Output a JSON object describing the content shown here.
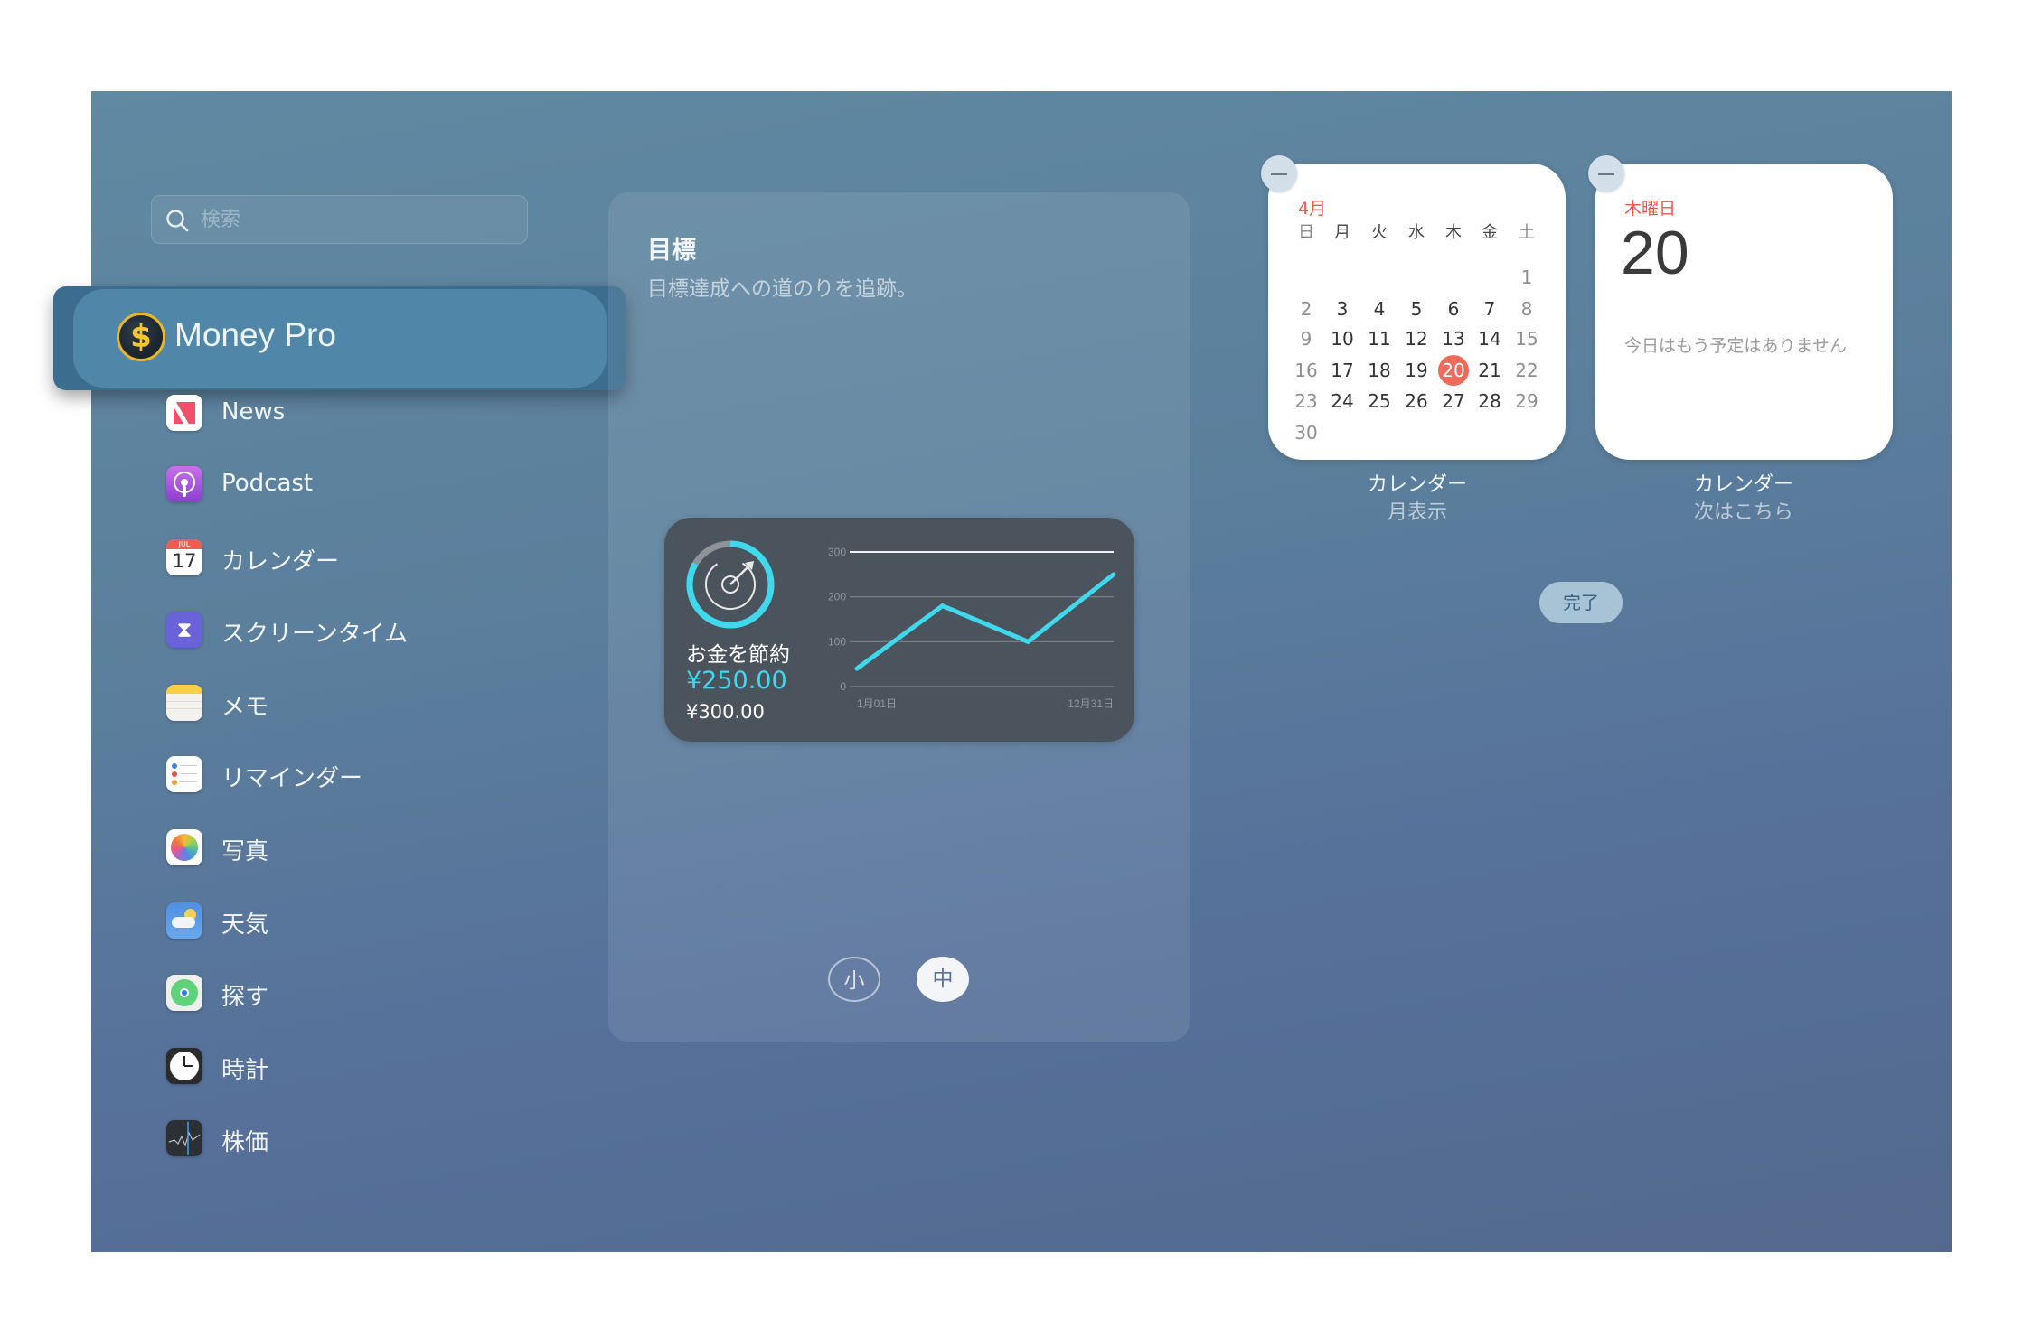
{
  "search": {
    "placeholder": "検索",
    "icon": "search-icon"
  },
  "sidebar": {
    "selected": {
      "label": "Money Pro",
      "icon": "money-pro-icon",
      "accent": "#e9b62b"
    },
    "items": [
      {
        "label": "News",
        "icon": "news-icon"
      },
      {
        "label": "Podcast",
        "icon": "podcast-icon"
      },
      {
        "label": "カレンダー",
        "icon": "calendar-icon",
        "icon_month": "JUL",
        "icon_day": "17"
      },
      {
        "label": "スクリーンタイム",
        "icon": "screen-time-icon"
      },
      {
        "label": "メモ",
        "icon": "notes-icon"
      },
      {
        "label": "リマインダー",
        "icon": "reminders-icon"
      },
      {
        "label": "写真",
        "icon": "photos-icon"
      },
      {
        "label": "天気",
        "icon": "weather-icon"
      },
      {
        "label": "探す",
        "icon": "find-my-icon"
      },
      {
        "label": "時計",
        "icon": "clock-icon"
      },
      {
        "label": "株価",
        "icon": "stocks-icon"
      }
    ]
  },
  "preview": {
    "title": "目標",
    "subtitle": "目標達成への道のりを追跡。",
    "widget": {
      "name": "お金を節約",
      "current": "¥250.00",
      "goal": "¥300.00",
      "progress_fraction": 0.8333,
      "accent": "#3fd8ec"
    },
    "sizes": [
      {
        "label": "小",
        "selected": false
      },
      {
        "label": "中",
        "selected": true
      }
    ]
  },
  "chart_data": {
    "type": "line",
    "x": [
      "1月01日",
      "",
      "",
      "12月31日"
    ],
    "x_tick_labels": [
      "1月01日",
      "12月31日"
    ],
    "y_ticks": [
      "0",
      "100",
      "200",
      "300"
    ],
    "ylim": [
      0,
      300
    ],
    "values": [
      40,
      180,
      100,
      250
    ],
    "goal_line": 300,
    "grid": true,
    "color": "#3fd8ec"
  },
  "calendar_month": {
    "month": "4月",
    "weekdays": [
      "日",
      "月",
      "火",
      "水",
      "木",
      "金",
      "土"
    ],
    "weeks": [
      [
        "",
        "",
        "",
        "",
        "",
        "",
        "1"
      ],
      [
        "2",
        "3",
        "4",
        "5",
        "6",
        "7",
        "8"
      ],
      [
        "9",
        "10",
        "11",
        "12",
        "13",
        "14",
        "15"
      ],
      [
        "16",
        "17",
        "18",
        "19",
        "20",
        "21",
        "22"
      ],
      [
        "23",
        "24",
        "25",
        "26",
        "27",
        "28",
        "29"
      ],
      [
        "30",
        "",
        "",
        "",
        "",
        "",
        ""
      ]
    ],
    "today": "20",
    "accent": "#ea5a48",
    "label": "カレンダー",
    "sublabel": "月表示"
  },
  "calendar_next": {
    "weekday": "木曜日",
    "day": "20",
    "message": "今日はもう予定はありません",
    "label": "カレンダー",
    "sublabel": "次はこちら"
  },
  "done_button": "完了"
}
